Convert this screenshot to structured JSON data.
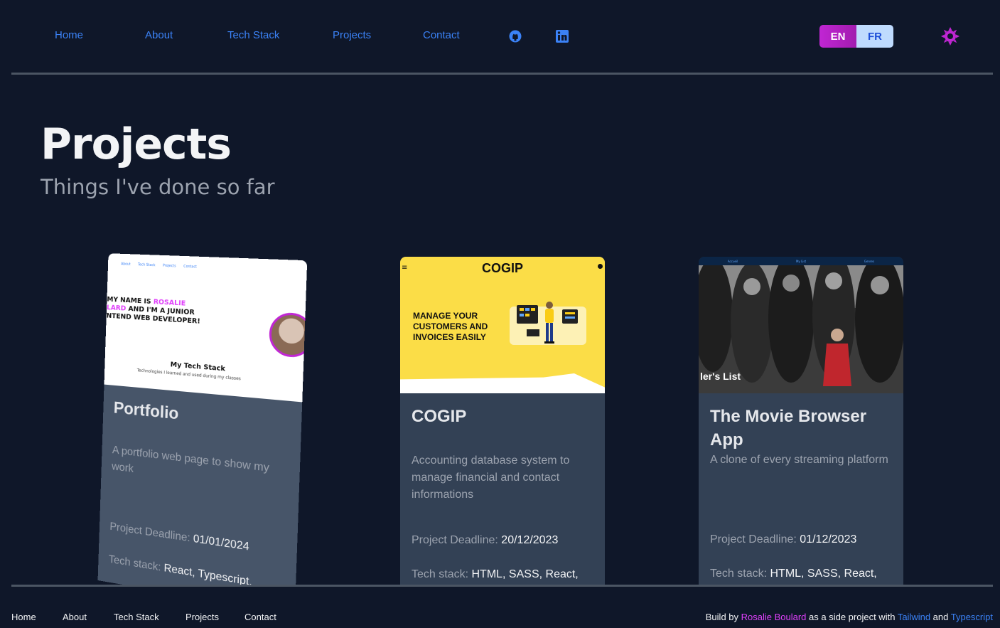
{
  "nav": {
    "items": [
      "Home",
      "About",
      "Tech Stack",
      "Projects",
      "Contact"
    ],
    "icons": [
      "github-icon",
      "linkedin-icon"
    ],
    "lang": {
      "en": "EN",
      "fr": "FR"
    },
    "theme_icon": "sun-icon"
  },
  "page": {
    "title": "Projects",
    "subtitle": "Things I've done so far"
  },
  "cards": [
    {
      "title": "Portfolio",
      "description": "A portfolio web page to show my work",
      "deadline_label": "Project Deadline:",
      "deadline": "01/01/2024",
      "stack_label": "Tech stack:",
      "stack": "React, Typescript,",
      "preview": {
        "nav": [
          "About",
          "Tech Stack",
          "Projects",
          "Contact"
        ],
        "headline_a": "MY NAME IS ",
        "headline_b": "ROSALIE",
        "headline_c": "LARD",
        "headline_d": " AND I'M A JUNIOR",
        "headline_e": "NTEND WEB DEVELOPER!",
        "techstack": "My Tech Stack",
        "techstack_sub": "Technologies I learned and used during my classes"
      }
    },
    {
      "title": "COGIP",
      "description": "Accounting database system to manage financial and contact informations",
      "deadline_label": "Project Deadline:",
      "deadline": "20/12/2023",
      "stack_label": "Tech stack:",
      "stack": "HTML, SASS, React,",
      "preview": {
        "logo": "COGIP",
        "tagline": "MANAGE YOUR CUSTOMERS AND INVOICES EASILY",
        "menu": "≡"
      }
    },
    {
      "title": "The Movie Browser App",
      "description": "A clone of every streaming platform",
      "deadline_label": "Project Deadline:",
      "deadline": "01/12/2023",
      "stack_label": "Tech stack:",
      "stack": "HTML, SASS, React,",
      "preview": {
        "nav": [
          "Accueil",
          "My List",
          "Genres"
        ],
        "caption": "ler's List"
      }
    }
  ],
  "footer": {
    "links": [
      "Home",
      "About",
      "Tech Stack",
      "Projects",
      "Contact"
    ],
    "credit_prefix": "Build by ",
    "credit_name": "Rosalie Boulard",
    "credit_mid": " as a side project with ",
    "credit_tech1": "Tailwind",
    "credit_and": " and ",
    "credit_tech2": "Typescript"
  },
  "colors": {
    "accent": "#3b82f6",
    "brand": "#c026d3",
    "background": "#0f1729"
  }
}
